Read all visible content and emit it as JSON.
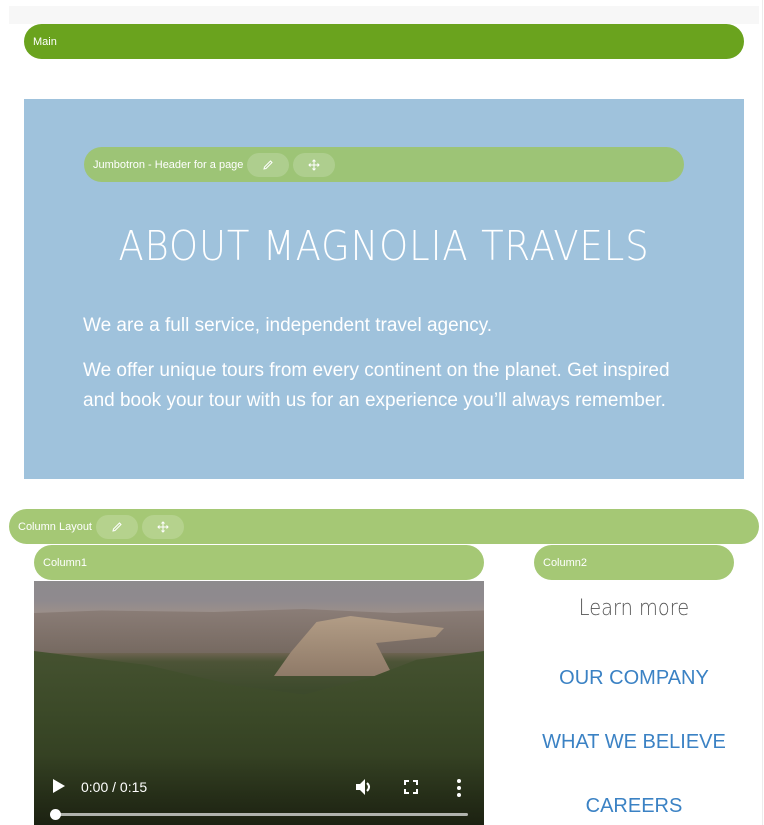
{
  "editor": {
    "main_label": "Main",
    "jumbotron_label": "Jumbotron - Header for a page",
    "column_layout_label": "Column Layout",
    "column1_label": "Column1",
    "column2_label": "Column2",
    "edit_icon": "pencil-icon",
    "move_icon": "move-arrows-icon"
  },
  "jumbotron": {
    "heading": "ABOUT MAGNOLIA TRAVELS",
    "paragraphs": [
      "We are a full service, independent travel agency.",
      "We offer unique tours from every continent on the planet. Get inspired and book your tour with us for an experience you’ll always remember."
    ]
  },
  "video": {
    "time_display": "0:00 / 0:15",
    "progress_fraction": 0,
    "icons": [
      "play-icon",
      "volume-icon",
      "fullscreen-icon",
      "more-options-icon"
    ]
  },
  "column2": {
    "heading": "Learn more",
    "links": [
      "OUR COMPANY",
      "WHAT WE BELIEVE",
      "CAREERS"
    ]
  },
  "colors": {
    "main_bar": "#6aa31e",
    "component_bar": "#a5c875",
    "jumbotron_bg": "#9fc2dc",
    "link": "#3b82c4"
  }
}
